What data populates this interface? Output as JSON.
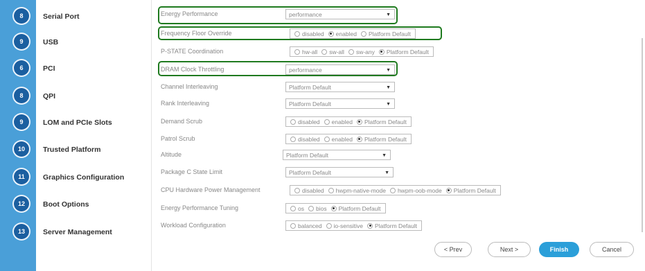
{
  "sidebar": {
    "steps": [
      {
        "num": "8",
        "label": "Serial Port"
      },
      {
        "num": "9",
        "label": "USB"
      },
      {
        "num": "6",
        "label": "PCI"
      },
      {
        "num": "8",
        "label": "QPI"
      },
      {
        "num": "9",
        "label": "LOM and PCIe Slots"
      },
      {
        "num": "10",
        "label": "Trusted Platform"
      },
      {
        "num": "11",
        "label": "Graphics Configuration"
      },
      {
        "num": "12",
        "label": "Boot Options"
      },
      {
        "num": "13",
        "label": "Server Management"
      }
    ]
  },
  "settings": [
    {
      "label": "Energy Performance",
      "type": "select",
      "value": "performance"
    },
    {
      "label": "Frequency Floor Override",
      "type": "radio",
      "options": [
        {
          "label": "disabled",
          "selected": false
        },
        {
          "label": "enabled",
          "selected": true
        },
        {
          "label": "Platform Default",
          "selected": false
        }
      ]
    },
    {
      "label": "P-STATE Coordination",
      "type": "radio",
      "options": [
        {
          "label": "hw-all",
          "selected": false
        },
        {
          "label": "sw-all",
          "selected": false
        },
        {
          "label": "sw-any",
          "selected": false
        },
        {
          "label": "Platform Default",
          "selected": true
        }
      ]
    },
    {
      "label": "DRAM Clock Throttling",
      "type": "select",
      "value": "performance"
    },
    {
      "label": "Channel Interleaving",
      "type": "select",
      "value": "Platform Default"
    },
    {
      "label": "Rank Interleaving",
      "type": "select",
      "value": "Platform Default"
    },
    {
      "label": "Demand Scrub",
      "type": "radio",
      "options": [
        {
          "label": "disabled",
          "selected": false
        },
        {
          "label": "enabled",
          "selected": false
        },
        {
          "label": "Platform Default",
          "selected": true
        }
      ]
    },
    {
      "label": "Patrol Scrub",
      "type": "radio",
      "options": [
        {
          "label": "disabled",
          "selected": false
        },
        {
          "label": "enabled",
          "selected": false
        },
        {
          "label": "Platform Default",
          "selected": true
        }
      ]
    },
    {
      "label": "Altitude",
      "type": "select",
      "value": "Platform Default"
    },
    {
      "label": "Package C State Limit",
      "type": "select",
      "value": "Platform Default"
    },
    {
      "label": "CPU Hardware Power Management",
      "type": "radio",
      "options": [
        {
          "label": "disabled",
          "selected": false
        },
        {
          "label": "hwpm-native-mode",
          "selected": false
        },
        {
          "label": "hwpm-oob-mode",
          "selected": false
        },
        {
          "label": "Platform Default",
          "selected": true
        }
      ]
    },
    {
      "label": "Energy Performance Tuning",
      "type": "radio",
      "options": [
        {
          "label": "os",
          "selected": false
        },
        {
          "label": "bios",
          "selected": false
        },
        {
          "label": "Platform Default",
          "selected": true
        }
      ]
    },
    {
      "label": "Workload Configuration",
      "type": "radio",
      "options": [
        {
          "label": "balanced",
          "selected": false
        },
        {
          "label": "io-sensitive",
          "selected": false
        },
        {
          "label": "Platform Default",
          "selected": true
        }
      ]
    }
  ],
  "buttons": {
    "prev": "< Prev",
    "next": "Next >",
    "finish": "Finish",
    "cancel": "Cancel"
  },
  "colors": {
    "rail": "#4a9fd8",
    "step_circle": "#1b5fa0",
    "highlight": "#1f7a1f",
    "primary_button": "#2b9fd9"
  }
}
